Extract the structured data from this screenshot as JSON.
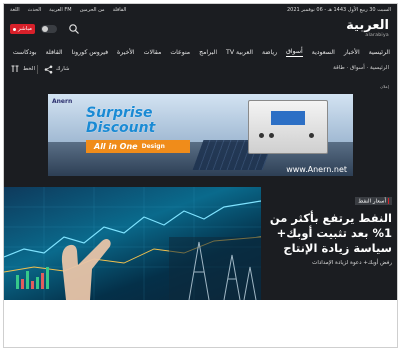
{
  "top_strip": {
    "date": "السبت 30 ربيع الأول 1443 هـ - 06 نوفمبر 2021",
    "links": [
      "اللغة",
      "الحدث",
      "العربية FM",
      "من الحرمين",
      "القافلة"
    ]
  },
  "brand": {
    "name_ar": "العربية",
    "name_lat": "alarabiya"
  },
  "live_button": {
    "label": "مباشر"
  },
  "nav": {
    "items": [
      "الرئيسية",
      "الأخبار",
      "السعودية",
      "أسواق",
      "رياضة",
      "العربية TV",
      "البرامج",
      "منوعات",
      "مقالات",
      "الأخيرة",
      "فيروس كورونا",
      "القافلة",
      "بودكاست"
    ],
    "active_index": 3
  },
  "breadcrumb": "الرئيسية · أسواق · طاقة",
  "tools": {
    "share_label": "شارك",
    "text_size_label": "الخط"
  },
  "ad": {
    "label": "إعلان",
    "brand": "Anern",
    "headline_line1": "Surprise",
    "headline_line2": "Discount",
    "bar_text": "All in One",
    "bar_small": "Design",
    "url": "www.Anern.net"
  },
  "article": {
    "tag": "أسعار النفط",
    "title": "النفط يرتفع بأكثر من 1% بعد تثبيت أوبك+ سياسة زيادة الإنتاج",
    "subtitle": "رفض أوبك+ دعوة لزيادة الإمدادات"
  }
}
